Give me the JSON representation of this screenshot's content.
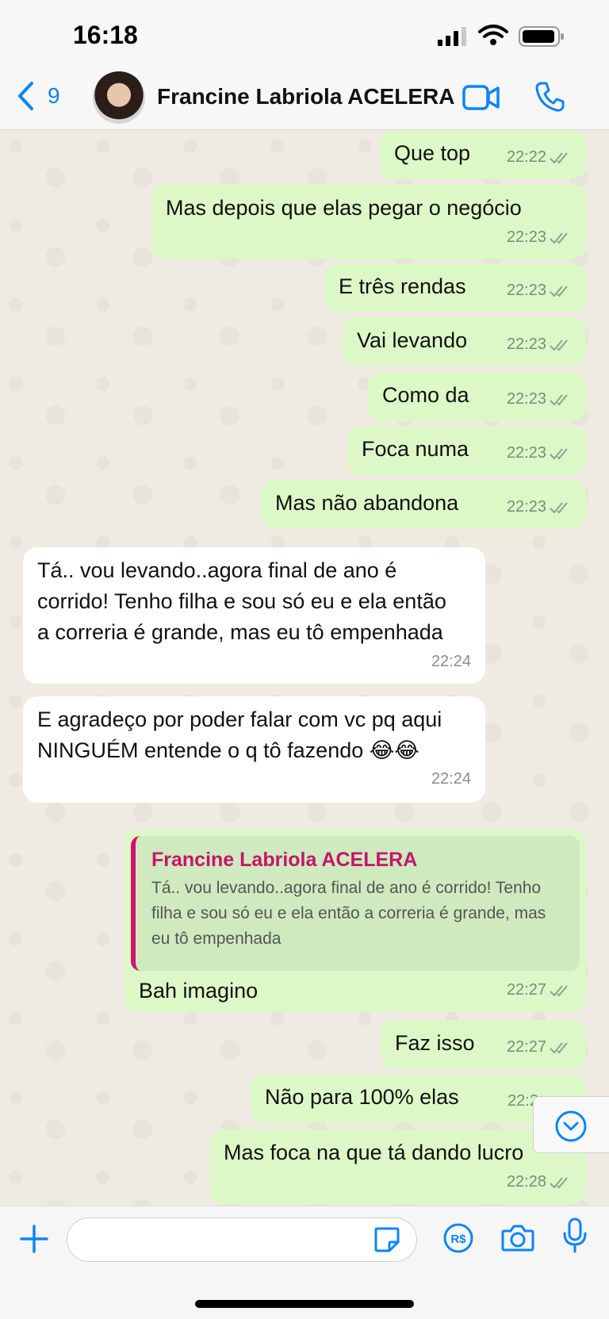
{
  "status_bar": {
    "time": "16:18"
  },
  "header": {
    "back_count": "9",
    "contact_name": "Francine Labriola ACELERA"
  },
  "messages": [
    {
      "text": "Que top",
      "time": "22:22"
    },
    {
      "text": "Mas depois que elas pegar o negócio",
      "time": "22:23"
    },
    {
      "text": "E três rendas",
      "time": "22:23"
    },
    {
      "text": "Vai levando",
      "time": "22:23"
    },
    {
      "text": "Como da",
      "time": "22:23"
    },
    {
      "text": "Foca numa",
      "time": "22:23"
    },
    {
      "text": "Mas não abandona",
      "time": "22:23"
    },
    {
      "text": "Tá.. vou levando..agora final de ano é corrido! Tenho filha e sou só eu e ela então a correria é grande, mas eu tô empenhada",
      "time": "22:24"
    },
    {
      "text": "E agradeço por poder falar com vc pq aqui NINGUÉM entende o q tô fazendo 😂😂",
      "time": "22:24"
    },
    {
      "quoted_name": "Francine Labriola ACELERA",
      "quoted_text": "Tá.. vou levando..agora final de ano é corrido! Tenho filha e sou só eu e ela então a correria é grande, mas eu tô empenhada",
      "text": "Bah imagino",
      "time": "22:27"
    },
    {
      "text": "Faz isso",
      "time": "22:27"
    },
    {
      "text": "Não para 100% elas",
      "time": "22:2"
    },
    {
      "text": "Mas foca na que tá dando lucro",
      "time": "22:28"
    }
  ],
  "colors": {
    "accent": "#0a84ff",
    "outgoing_bubble": "#dcf8c6",
    "quote_bar": "#d1136e"
  }
}
